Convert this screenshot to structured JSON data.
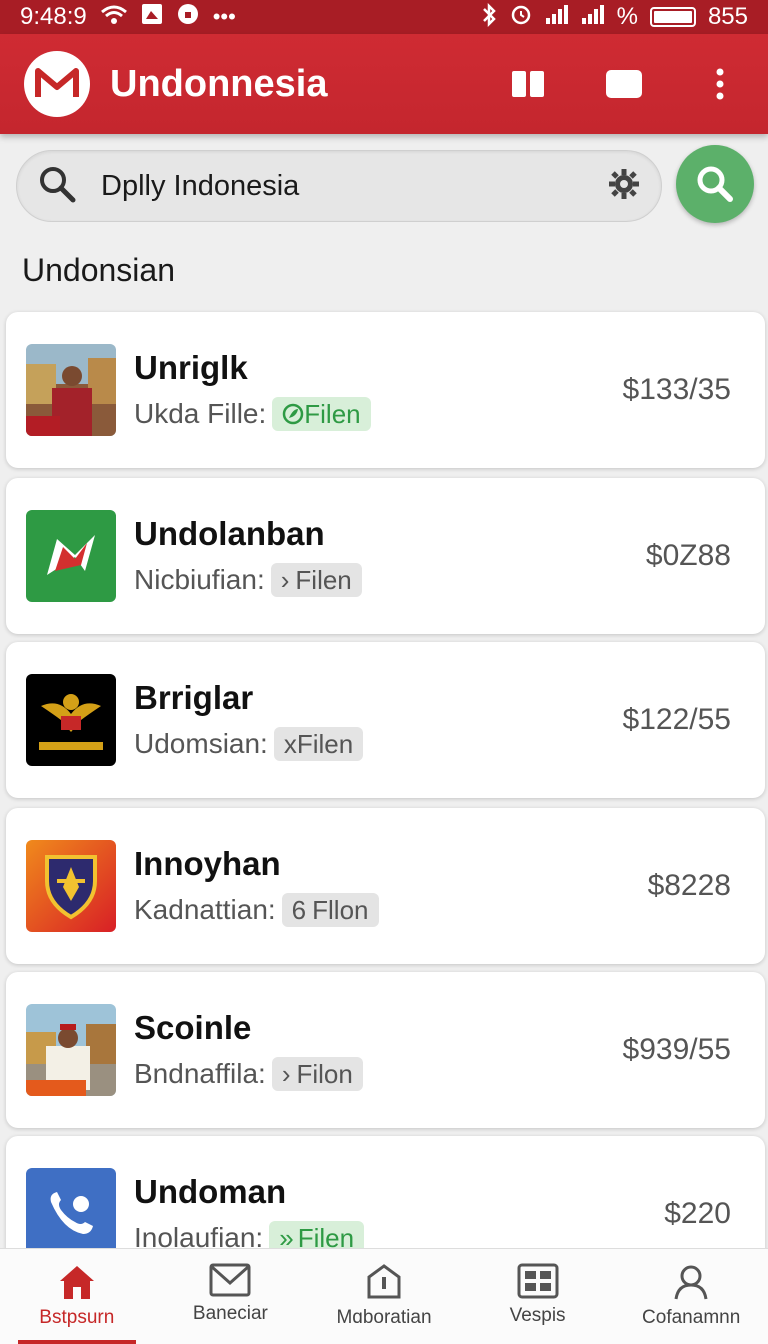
{
  "status_bar": {
    "time": "9:48:9",
    "battery": "855",
    "percent_glyph": "%",
    "dots": "•••",
    "accent": "#a81d25"
  },
  "app_bar": {
    "title": "Undonnesia",
    "logo_icon": "m-logo-icon",
    "actions": [
      "book-icon",
      "message-icon",
      "more-vert-icon"
    ],
    "color": "#c62828"
  },
  "search": {
    "value": "Dplly Indonesia",
    "fab_color": "#5cb06a"
  },
  "section_title": "Undonsian",
  "items": [
    {
      "name": "Unriglk",
      "subtitle": "Ukda Fille:",
      "chip": "Filen",
      "chip_icon": "leaf-icon",
      "chip_style": "green",
      "price": "$133/35",
      "thumb": "photo-thumb"
    },
    {
      "name": "Undolanban",
      "subtitle": "Nicbiufian:",
      "chip": "Filen",
      "chip_icon": "chevron-icon",
      "chip_style": "grey",
      "price": "$0Z88",
      "thumb": "green-logo-thumb"
    },
    {
      "name": "Brriglar",
      "subtitle": "Udomsian:",
      "chip": "Filen",
      "chip_icon": "x-icon",
      "chip_style": "grey",
      "price": "$122/55",
      "thumb": "garuda-thumb"
    },
    {
      "name": "Innoyhan",
      "subtitle": "Kadnattian:",
      "chip": "Fllon",
      "chip_icon": "six-icon",
      "chip_style": "grey",
      "price": "$8228",
      "thumb": "shield-thumb"
    },
    {
      "name": "Scoinle",
      "subtitle": "Bndnaffila:",
      "chip": "Filon",
      "chip_icon": "chevron-icon",
      "chip_style": "grey",
      "price": "$939/55",
      "thumb": "photo-thumb-2"
    },
    {
      "name": "Undoman",
      "subtitle": "Inolaufian:",
      "chip": "Filen",
      "chip_icon": "double-chevron-icon",
      "chip_style": "green",
      "price": "$220",
      "thumb": "phone-thumb"
    }
  ],
  "chip_glyphs": {
    "chevron-icon": "›",
    "x-icon": "x",
    "six-icon": "6",
    "double-chevron-icon": "»"
  },
  "bottom_nav": [
    {
      "label": "Bstpsurn",
      "icon": "home-icon",
      "active": true
    },
    {
      "label": "Baneciar",
      "icon": "mail-icon",
      "active": false
    },
    {
      "label": "Mɑboratian",
      "icon": "badge-icon",
      "active": false
    },
    {
      "label": "Vespis",
      "icon": "grid-icon",
      "active": false
    },
    {
      "label": "Cofanamnn",
      "icon": "user-icon",
      "active": false
    }
  ]
}
